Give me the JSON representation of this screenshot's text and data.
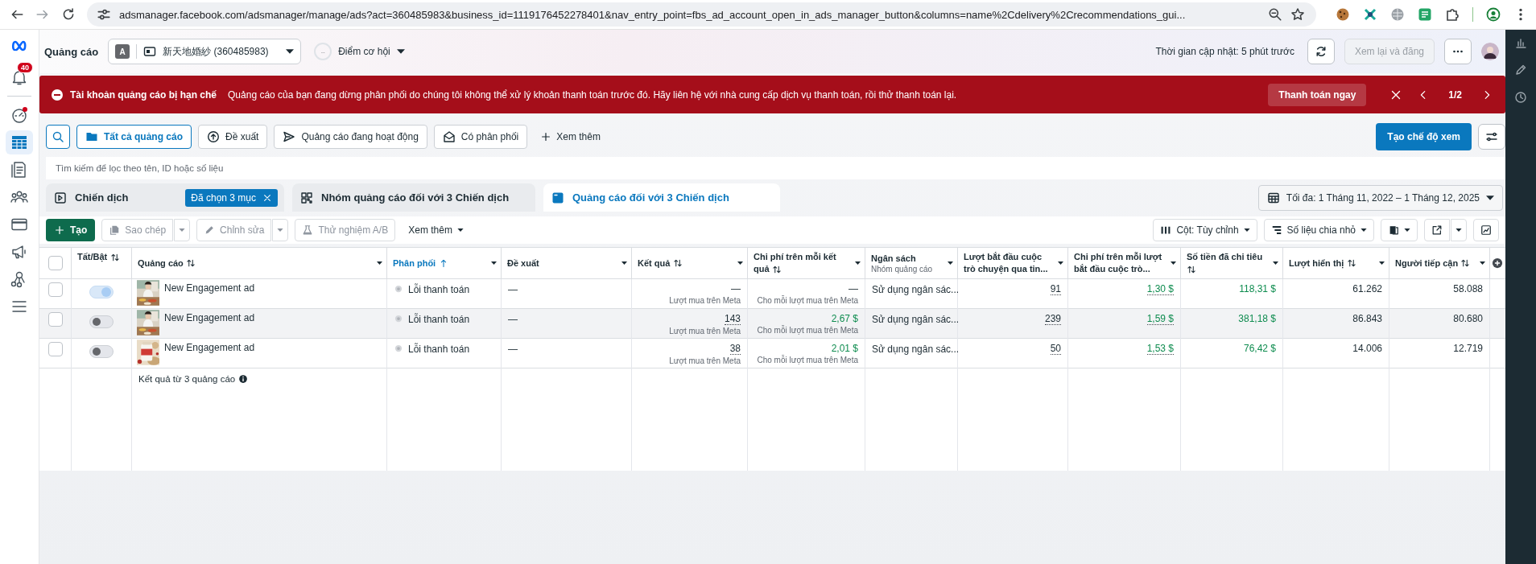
{
  "browser": {
    "url": "adsmanager.facebook.com/adsmanager/manage/ads?act=360485983&business_id=1119176452278401&nav_entry_point=fbs_ad_account_open_in_ads_manager_button&columns=name%2Cdelivery%2Crecommendations_gui..."
  },
  "nav": [
    {
      "kind": "bell",
      "badge": "40",
      "alert": false,
      "selected": false
    },
    {
      "kind": "gauge",
      "alert": true,
      "selected": false
    },
    {
      "kind": "table",
      "alert": false,
      "selected": true
    },
    {
      "kind": "document",
      "alert": false,
      "selected": false
    },
    {
      "kind": "people",
      "alert": false,
      "selected": false
    },
    {
      "kind": "card",
      "alert": false,
      "selected": false
    },
    {
      "kind": "megaphone",
      "alert": false,
      "selected": false
    },
    {
      "kind": "network",
      "alert": false,
      "selected": false
    },
    {
      "kind": "menu",
      "alert": false,
      "selected": false
    }
  ],
  "header": {
    "title": "Quảng cáo",
    "account_initial": "A",
    "account_name": "新天地婚紗 (360485983)",
    "opportunity_score": "--",
    "opportunity_label": "Điểm cơ hội",
    "updated": "Thời gian cập nhật: 5 phút trước",
    "review_button": {
      "label": "Xem lại và đăng",
      "disabled": true
    }
  },
  "banner": {
    "title": "Tài khoản quảng cáo bị hạn chế",
    "message": "Quảng cáo của bạn đang dừng phân phối do chúng tôi không thể xử lý khoản thanh toán trước đó. Hãy liên hệ với nhà cung cấp dịch vụ thanh toán, rồi thử thanh toán lại.",
    "action": "Thanh toán ngay",
    "pager": "1/2"
  },
  "filters": {
    "tabs": [
      {
        "label": "Tất cả quảng cáo",
        "kind": "folder",
        "selected": true
      },
      {
        "label": "Đề xuất",
        "kind": "recommend",
        "selected": false
      },
      {
        "label": "Quảng cáo đang hoạt động",
        "kind": "send",
        "selected": false
      },
      {
        "label": "Có phân phối",
        "kind": "mail",
        "selected": false
      }
    ],
    "more": "Xem thêm",
    "create_view": "Tạo chế độ xem",
    "search_placeholder": "Tìm kiếm để lọc theo tên, ID hoặc số liệu"
  },
  "levels": [
    {
      "label": "Chiến dịch",
      "kind": "campaign",
      "selected": false,
      "chip": "Đã chọn 3 mục"
    },
    {
      "label": "Nhóm quảng cáo đối với 3 Chiến dịch",
      "kind": "adset",
      "selected": false
    },
    {
      "label": "Quảng cáo đối với 3 Chiến dịch",
      "kind": "ad",
      "selected": true
    }
  ],
  "date_range": "Tối đa: 1 Tháng 11, 2022 – 1 Tháng 12, 2025",
  "actions": {
    "left": [
      {
        "label": "Tạo",
        "kind": "create",
        "disabled": false,
        "dropdown": false
      },
      {
        "label": "Sao chép",
        "kind": "copy",
        "disabled": true,
        "dropdown": true
      },
      {
        "label": "Chỉnh sửa",
        "kind": "edit",
        "disabled": true,
        "dropdown": true
      },
      {
        "label": "Thử nghiệm A/B",
        "kind": "flask",
        "disabled": true,
        "dropdown": false
      }
    ],
    "more": "Xem thêm",
    "right": [
      {
        "label": "Cột: Tùy chỉnh",
        "kind": "columns",
        "dropdown": true,
        "split": false
      },
      {
        "label": "Số liệu chia nhỏ",
        "kind": "breakdown",
        "dropdown": true,
        "split": false
      },
      {
        "kind": "reports",
        "dropdown": true,
        "split": false
      },
      {
        "kind": "export",
        "dropdown": true,
        "split": true
      },
      {
        "kind": "chart",
        "dropdown": false,
        "split": false
      }
    ]
  },
  "table": {
    "all_selected": false,
    "columns": [
      {
        "label": "Tất/Bật",
        "kind": "toggle",
        "sortable": true,
        "sorted": false,
        "menu": false
      },
      {
        "label": "Quảng cáo",
        "kind": "ad",
        "sortable": true,
        "sorted": false,
        "menu": true
      },
      {
        "label": "Phân phối",
        "kind": "status",
        "sortable": true,
        "sorted": true,
        "menu": true
      },
      {
        "label": "Đề xuất",
        "kind": "text",
        "sortable": false,
        "sorted": false,
        "menu": true
      },
      {
        "label": "Kết quả",
        "kind": "metric",
        "sortable": true,
        "sorted": false,
        "menu": true
      },
      {
        "label": "Chi phí trên mỗi kết quả",
        "kind": "metric",
        "sortable": true,
        "sorted": false,
        "menu": true
      },
      {
        "label": "Ngân sách",
        "sub": "Nhóm quảng cáo",
        "kind": "text",
        "sortable": false,
        "sorted": false,
        "menu": true
      },
      {
        "label": "Lượt bắt đầu cuộc trò chuyện qua tin...",
        "kind": "metric",
        "sortable": false,
        "sorted": false,
        "menu": true
      },
      {
        "label": "Chi phí trên mỗi lượt bắt đầu cuộc trò...",
        "kind": "metric",
        "sortable": false,
        "sorted": false,
        "menu": true
      },
      {
        "label": "Số tiền đã chi tiêu",
        "kind": "metric",
        "sortable": true,
        "sorted": false,
        "menu": true
      },
      {
        "label": "Lượt hiển thị",
        "kind": "metric",
        "sortable": true,
        "sorted": false,
        "menu": true
      },
      {
        "label": "Người tiếp cận",
        "kind": "metric",
        "sortable": true,
        "sorted": false,
        "menu": true
      }
    ],
    "rows": [
      {
        "selected": false,
        "highlighted": false,
        "cells": [
          {
            "on": true
          },
          {
            "text": "New Engagement ad"
          },
          {
            "text": "Lỗi thanh toán"
          },
          {
            "text": "—"
          },
          {
            "value": "—",
            "sub": "Lượt mua trên Meta",
            "underline": false,
            "positive": false
          },
          {
            "value": "—",
            "sub": "Cho mỗi lượt mua trên Meta",
            "underline": false,
            "positive": false
          },
          {
            "text": "Sử dụng ngân sác..."
          },
          {
            "value": "91",
            "underline": true,
            "positive": false
          },
          {
            "value": "1,30 $",
            "underline": true,
            "positive": true
          },
          {
            "value": "118,31 $",
            "underline": false,
            "positive": true
          },
          {
            "value": "61.262",
            "underline": false,
            "positive": false
          },
          {
            "value": "58.088",
            "underline": false,
            "positive": false
          }
        ]
      },
      {
        "selected": false,
        "highlighted": true,
        "cells": [
          {
            "on": false
          },
          {
            "text": "New Engagement ad"
          },
          {
            "text": "Lỗi thanh toán"
          },
          {
            "text": "—"
          },
          {
            "value": "143",
            "sub": "Lượt mua trên Meta",
            "underline": true,
            "positive": false
          },
          {
            "value": "2,67 $",
            "sub": "Cho mỗi lượt mua trên Meta",
            "underline": false,
            "positive": true
          },
          {
            "text": "Sử dụng ngân sác..."
          },
          {
            "value": "239",
            "underline": true,
            "positive": false
          },
          {
            "value": "1,59 $",
            "underline": true,
            "positive": true
          },
          {
            "value": "381,18 $",
            "underline": false,
            "positive": true
          },
          {
            "value": "86.843",
            "underline": false,
            "positive": false
          },
          {
            "value": "80.680",
            "underline": false,
            "positive": false
          }
        ]
      },
      {
        "selected": false,
        "highlighted": false,
        "cells": [
          {
            "on": false
          },
          {
            "text": "New Engagement ad"
          },
          {
            "text": "Lỗi thanh toán"
          },
          {
            "text": "—"
          },
          {
            "value": "38",
            "sub": "Lượt mua trên Meta",
            "underline": true,
            "positive": false
          },
          {
            "value": "2,01 $",
            "sub": "Cho mỗi lượt mua trên Meta",
            "underline": false,
            "positive": true
          },
          {
            "text": "Sử dụng ngân sác..."
          },
          {
            "value": "50",
            "underline": true,
            "positive": false
          },
          {
            "value": "1,53 $",
            "underline": true,
            "positive": true
          },
          {
            "value": "76,42 $",
            "underline": false,
            "positive": true
          },
          {
            "value": "14.006",
            "underline": false,
            "positive": false
          },
          {
            "value": "12.719",
            "underline": false,
            "positive": false
          }
        ]
      }
    ],
    "footer": "Kết quả từ 3 quảng cáo"
  }
}
